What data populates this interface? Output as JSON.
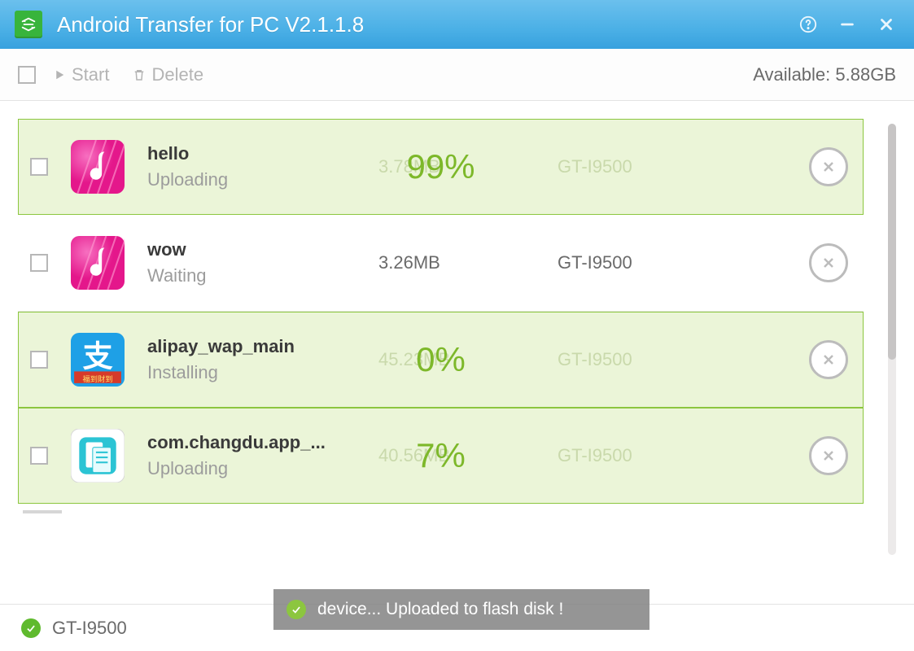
{
  "titlebar": {
    "app_name": "Android Transfer for PC V2.1.1.8"
  },
  "toolbar": {
    "start_label": "Start",
    "delete_label": "Delete",
    "available_label": "Available: 5.88GB"
  },
  "items": [
    {
      "name": "hello",
      "status": "Uploading",
      "size": "3.78MB",
      "device": "GT-I9500",
      "progress": "99%",
      "active": true,
      "icon": "music"
    },
    {
      "name": "wow",
      "status": "Waiting",
      "size": "3.26MB",
      "device": "GT-I9500",
      "progress": "",
      "active": false,
      "icon": "music"
    },
    {
      "name": "alipay_wap_main",
      "status": "Installing",
      "size": "45.23MB",
      "device": "GT-I9500",
      "progress": "0%",
      "active": true,
      "icon": "alipay"
    },
    {
      "name": "com.changdu.app_...",
      "status": "Uploading",
      "size": "40.56MB",
      "device": "GT-I9500",
      "progress": "7%",
      "active": true,
      "icon": "doc"
    }
  ],
  "toast": {
    "text": "device... Uploaded to flash disk !"
  },
  "statusbar": {
    "device": "GT-I9500"
  }
}
